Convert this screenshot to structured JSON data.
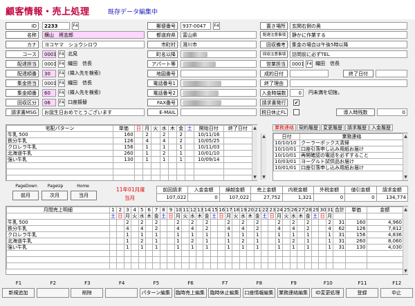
{
  "header": {
    "title": "顧客情報・売上処理",
    "subtitle": "既存データ編集中"
  },
  "fields": {
    "id": {
      "label": "ID",
      "value": "2233"
    },
    "name": {
      "label": "名称",
      "value": "横山　将志郎"
    },
    "kana": {
      "label": "カナ",
      "value": "ヨコヤマ　ショウシロウ"
    },
    "course": {
      "label": "コース",
      "code": "0001",
      "value": "北見"
    },
    "delivery_staff": {
      "label": "配達担当",
      "code": "0001",
      "value": "織田　信長"
    },
    "delivery_order": {
      "label": "配達順番",
      "code": "30",
      "value": "(挿入先を検索)"
    },
    "collect_staff": {
      "label": "集金担当",
      "code": "0001",
      "value": "織田　信長"
    },
    "collect_order": {
      "label": "集金順番",
      "code": "60",
      "value": "(挿入先を検索)"
    },
    "collect_type": {
      "label": "回収区分",
      "code": "06",
      "value": "口座振替"
    },
    "invoice_msg": {
      "label": "請求書MSG",
      "value": "お誕生日おめでとうございます"
    },
    "postal": {
      "label": "郵便番号",
      "value": "937-0047"
    },
    "prefecture": {
      "label": "都道府県",
      "value": "富山県"
    },
    "city": {
      "label": "市町村",
      "value": "滑川市"
    },
    "address": {
      "label": "町名以降"
    },
    "apartment": {
      "label": "アパート等"
    },
    "map_number": {
      "label": "地図番号"
    },
    "phone1": {
      "label": "電話番号1"
    },
    "phone2": {
      "label": "電話番号2"
    },
    "fax": {
      "label": "FAX番号"
    },
    "email": {
      "label": "E-MAIL"
    },
    "placement": {
      "label": "置き場所",
      "value": "玄関右側の奥"
    },
    "delivery_notes": {
      "label": "配達注意事項",
      "value": "静かに作業する"
    },
    "collect_time": {
      "label": "回収備考",
      "value": "集金の場合は午後5時以降"
    },
    "collect_notes": {
      "label": "回収注意事項",
      "value": "訪問前に必ずTEL"
    },
    "sales_staff": {
      "label": "営業担当",
      "code": "0001",
      "value": "織田　信長"
    },
    "contract_date": {
      "label": "成約日付"
    },
    "end_date": {
      "label": "終了日付"
    },
    "end_reason": {
      "label": "終了理由"
    },
    "deposit": {
      "label": "入金時端数",
      "code": "0",
      "value": "円未満を切捨。"
    },
    "invoice_issue": {
      "label": "請求書発行",
      "check": "✔"
    },
    "tax_holiday": {
      "label": "税日休止FL"
    },
    "intro_count": {
      "label": "導入時残数",
      "value": "0"
    }
  },
  "f4_label": "F4",
  "delivery_pattern": {
    "headers": [
      "宅配パターン",
      "単価",
      "日",
      "月",
      "火",
      "水",
      "木",
      "金",
      "土",
      "開始日付",
      "終了日付"
    ],
    "rows": [
      [
        "牛乳 500",
        "160",
        "",
        "2",
        "",
        "2",
        "",
        "2",
        "",
        "10/11/16",
        ""
      ],
      [
        "鉄分牛乳",
        "126",
        "",
        "4",
        "",
        "4",
        "",
        "2",
        "",
        "10/05/25",
        ""
      ],
      [
        "クロレラ牛乳",
        "156",
        "",
        "1",
        "",
        "1",
        "",
        "1",
        "",
        "10/11/03",
        ""
      ],
      [
        "北海道牛乳",
        "260",
        "",
        "1",
        "",
        "2",
        "",
        "1",
        "",
        "10/01/10",
        ""
      ],
      [
        "強い牛乳",
        "130",
        "",
        "1",
        "",
        "1",
        "",
        "1",
        "",
        "10/09/14",
        ""
      ],
      [
        "",
        "",
        "",
        "",
        "",
        "",
        "",
        "",
        "",
        "",
        ""
      ],
      [
        "",
        "",
        "",
        "",
        "",
        "",
        "",
        "",
        "",
        "",
        ""
      ],
      [
        "",
        "",
        "",
        "",
        "",
        "",
        "",
        "",
        "",
        "",
        ""
      ]
    ]
  },
  "history": {
    "tabs": [
      "業務連絡",
      "契約履歴",
      "変更履歴",
      "請求履歴",
      "入金履歴"
    ],
    "headers": [
      "日付",
      "業務連絡"
    ],
    "rows": [
      [
        "10/10/10",
        "クーラーボックス清掃"
      ],
      [
        "10/10/01",
        "口座引落申し込み用紙お届け"
      ],
      [
        "10/10/01",
        "再開確認の電話を必ずすること"
      ],
      [
        "10/03/01",
        "ヨーグルト試供品お届け"
      ],
      [
        "10/01/01",
        "口座引落申し込み用紙お届け"
      ]
    ]
  },
  "nav": {
    "pagedown": "PageDown",
    "pageup": "PageUp",
    "home": "Home",
    "prev": "前月",
    "next": "次月",
    "current": "当月",
    "period": "11年01月度",
    "period_sub": "当月"
  },
  "summary": {
    "headers": [
      "前回請求",
      "入金金額",
      "繰越金額",
      "売上金額",
      "内税金額",
      "外税金額",
      "値引金額",
      "請求金額"
    ],
    "values": [
      "107,022",
      "0",
      "107,022",
      "27,752",
      "1,321",
      "0",
      "0",
      "134,774"
    ]
  },
  "monthly": {
    "title": "月間売上明細",
    "days": [
      "1",
      "2",
      "3",
      "4",
      "5",
      "6",
      "7",
      "8",
      "9",
      "10",
      "11",
      "12",
      "13",
      "14",
      "15",
      "16",
      "17",
      "18",
      "19",
      "20",
      "21",
      "22",
      "23",
      "24",
      "25",
      "26",
      "27",
      "28",
      "29",
      "30",
      "31"
    ],
    "weekdays": [
      "土",
      "日",
      "月",
      "火",
      "水",
      "木",
      "金",
      "土",
      "日",
      "月",
      "火",
      "水",
      "木",
      "金",
      "土",
      "日",
      "月",
      "火",
      "水",
      "木",
      "金",
      "土",
      "日",
      "月",
      "火",
      "水",
      "木",
      "金",
      "土",
      "日",
      "月"
    ],
    "total_label": "合計",
    "price_label": "単価",
    "amount_label": "金額",
    "rows": [
      {
        "name": "牛乳 500",
        "total": "31",
        "price": "160",
        "amount": "4,960"
      },
      {
        "name": "鉄分牛乳",
        "total": "62",
        "price": "126",
        "amount": "7,812"
      },
      {
        "name": "クロレラ牛乳",
        "total": "31",
        "price": "156",
        "amount": "4,836"
      },
      {
        "name": "北海道牛乳",
        "total": "31",
        "price": "260",
        "amount": "8,060"
      },
      {
        "name": "強い牛乳",
        "total": "31",
        "price": "130",
        "amount": "4,030"
      }
    ]
  },
  "fkeys": [
    {
      "key": "F1",
      "label": "新規追加"
    },
    {
      "key": "F2",
      "label": ""
    },
    {
      "key": "F3",
      "label": "削除"
    },
    {
      "key": "F4",
      "label": ""
    },
    {
      "key": "F5",
      "label": "パターン編集"
    },
    {
      "key": "F6",
      "label": "臨時売上編集"
    },
    {
      "key": "F7",
      "label": "臨時休止編集"
    },
    {
      "key": "F8",
      "label": "口座情報編集"
    },
    {
      "key": "F9",
      "label": "業務連絡編集"
    },
    {
      "key": "F10",
      "label": "ID変更処理"
    },
    {
      "key": "F11",
      "label": "登録"
    },
    {
      "key": "F12",
      "label": "中止"
    }
  ]
}
